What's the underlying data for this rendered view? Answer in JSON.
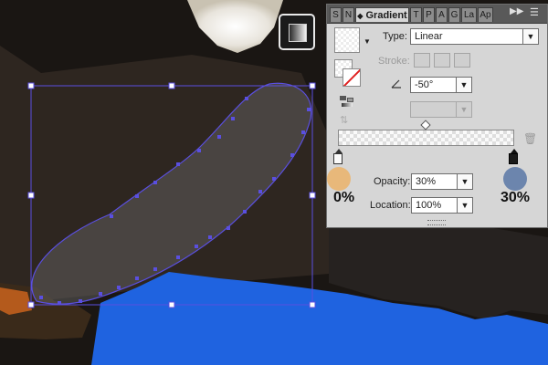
{
  "panel": {
    "tabs": [
      "S",
      "N",
      "T",
      "P",
      "A",
      "G",
      "La",
      "Ap"
    ],
    "active_tab": "Gradient",
    "expand_icon": "double-arrow-right-icon",
    "menu_icon": "panel-menu-icon",
    "type_label": "Type:",
    "type_value": "Linear",
    "stroke_label": "Stroke:",
    "angle_value": "-50°",
    "opacity_label": "Opacity:",
    "opacity_value": "30%",
    "location_label": "Location:",
    "location_value": "100%",
    "left_stop": {
      "percent": "0%",
      "color": "#e8b87a"
    },
    "right_stop": {
      "percent": "30%",
      "color": "#6c85ad"
    }
  },
  "canvas": {
    "background_color": "#1a1613",
    "water_color": "#1f63e0",
    "path_color": "#5a4fe0"
  }
}
